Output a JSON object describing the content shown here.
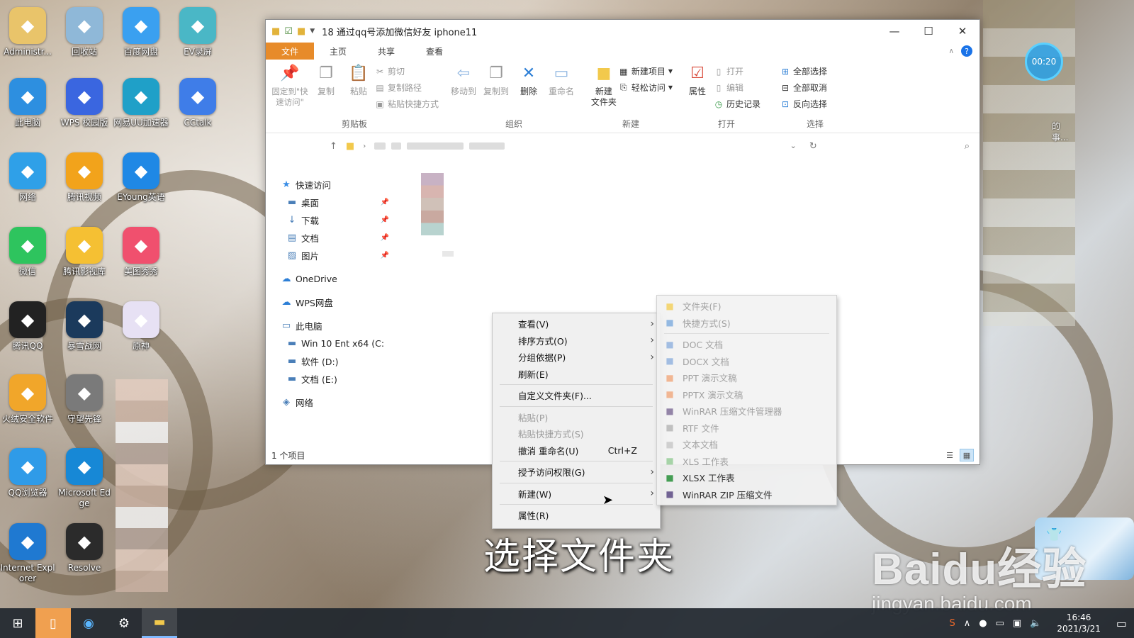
{
  "desktop": {
    "icons": [
      {
        "label": "Administr...",
        "icon": "user-icon",
        "color": "#e9c46a"
      },
      {
        "label": "回收站",
        "icon": "recycle-bin-icon",
        "color": "#8fb8d8"
      },
      {
        "label": "百度网盘",
        "icon": "baidu-netdisk-icon",
        "color": "#3aa0f0"
      },
      {
        "label": "EV录屏",
        "icon": "ev-recorder-icon",
        "color": "#4ab7c6"
      },
      {
        "label": "此电脑",
        "icon": "computer-icon",
        "color": "#2d8fe0"
      },
      {
        "label": "WPS 校园版",
        "icon": "wps-icon",
        "color": "#3a66e0"
      },
      {
        "label": "网易UU加速器",
        "icon": "uu-accelerator-icon",
        "color": "#1fa0c8"
      },
      {
        "label": "CCtalk",
        "icon": "cctalk-icon",
        "color": "#3f7de8"
      },
      {
        "label": "网络",
        "icon": "network-icon",
        "color": "#2fa0e8"
      },
      {
        "label": "腾讯视频",
        "icon": "tencent-video-icon",
        "color": "#f2a31b"
      },
      {
        "label": "EYoung英语",
        "icon": "eyoung-icon",
        "color": "#1f88e5"
      },
      {
        "label": "微信",
        "icon": "wechat-icon",
        "color": "#2ec45e"
      },
      {
        "label": "腾讯影视库",
        "icon": "tencent-film-icon",
        "color": "#f5c033"
      },
      {
        "label": "美图秀秀",
        "icon": "meitu-icon",
        "color": "#f0506e"
      },
      {
        "label": "腾讯QQ",
        "icon": "qq-icon",
        "color": "#222222"
      },
      {
        "label": "暴雪战网",
        "icon": "battlenet-icon",
        "color": "#1b3a5c"
      },
      {
        "label": "原神",
        "icon": "genshin-icon",
        "color": "#e7e1f4"
      },
      {
        "label": "火绒安全软件",
        "icon": "huorong-icon",
        "color": "#f1a62a"
      },
      {
        "label": "守望先锋",
        "icon": "overwatch-icon",
        "color": "#7a7a7a"
      },
      {
        "label": "QQ浏览器",
        "icon": "qq-browser-icon",
        "color": "#2f9be8"
      },
      {
        "label": "Microsoft Edge",
        "icon": "edge-icon",
        "color": "#1788d6"
      },
      {
        "label": "Internet Explorer",
        "icon": "ie-icon",
        "color": "#1f79d1"
      },
      {
        "label": "Resolve",
        "icon": "resolve-icon",
        "color": "#2b2b2b"
      }
    ]
  },
  "explorer": {
    "title": "18 通过qq号添加微信好友 iphone11",
    "tabs": [
      "文件",
      "主页",
      "共享",
      "查看"
    ],
    "ribbon": {
      "clipboard": {
        "name": "剪贴板",
        "pin": "固定到\"快速访问\"",
        "copy": "复制",
        "paste": "粘贴",
        "cut": "剪切",
        "copy_path": "复制路径",
        "paste_shortcut": "粘贴快捷方式"
      },
      "organize": {
        "name": "组织",
        "move_to": "移动到",
        "copy_to": "复制到",
        "delete": "删除",
        "rename": "重命名"
      },
      "new": {
        "name": "新建",
        "new_folder": "新建\n文件夹",
        "new_item": "新建项目",
        "easy_access": "轻松访问"
      },
      "open": {
        "name": "打开",
        "properties": "属性",
        "open": "打开",
        "edit": "编辑",
        "history": "历史记录"
      },
      "select": {
        "name": "选择",
        "select_all": "全部选择",
        "select_none": "全部取消",
        "invert": "反向选择"
      }
    },
    "nav": [
      {
        "label": "快速访问",
        "icon": "star-icon",
        "indent": 0,
        "pinned": false
      },
      {
        "label": "桌面",
        "icon": "desktop-folder-icon",
        "indent": 1,
        "pinned": true
      },
      {
        "label": "下载",
        "icon": "download-icon",
        "indent": 1,
        "pinned": true
      },
      {
        "label": "文档",
        "icon": "document-icon",
        "indent": 1,
        "pinned": true
      },
      {
        "label": "图片",
        "icon": "picture-icon",
        "indent": 1,
        "pinned": true
      },
      {
        "label": "OneDrive",
        "icon": "cloud-icon",
        "indent": 0,
        "pinned": false
      },
      {
        "label": "WPS网盘",
        "icon": "cloud-outline-icon",
        "indent": 0,
        "pinned": false
      },
      {
        "label": "此电脑",
        "icon": "computer-icon",
        "indent": 0,
        "pinned": false
      },
      {
        "label": "Win 10 Ent x64 (C:",
        "icon": "drive-icon",
        "indent": 1,
        "pinned": false
      },
      {
        "label": "软件 (D:)",
        "icon": "drive-icon",
        "indent": 1,
        "pinned": false
      },
      {
        "label": "文档 (E:)",
        "icon": "drive-icon",
        "indent": 1,
        "pinned": false
      },
      {
        "label": "网络",
        "icon": "network-icon",
        "indent": 0,
        "pinned": false
      }
    ],
    "status": "1 个项目"
  },
  "context_menu": {
    "items": [
      {
        "label": "查看(V)",
        "submenu": true,
        "disabled": false
      },
      {
        "label": "排序方式(O)",
        "submenu": true,
        "disabled": false
      },
      {
        "label": "分组依据(P)",
        "submenu": true,
        "disabled": false
      },
      {
        "label": "刷新(E)",
        "submenu": false,
        "disabled": false
      },
      {
        "sep": true
      },
      {
        "label": "自定义文件夹(F)...",
        "submenu": false,
        "disabled": false
      },
      {
        "sep": true
      },
      {
        "label": "粘贴(P)",
        "submenu": false,
        "disabled": true
      },
      {
        "label": "粘贴快捷方式(S)",
        "submenu": false,
        "disabled": true
      },
      {
        "label": "撤消 重命名(U)",
        "shortcut": "Ctrl+Z",
        "submenu": false,
        "disabled": false
      },
      {
        "sep": true
      },
      {
        "label": "授予访问权限(G)",
        "submenu": true,
        "disabled": false
      },
      {
        "sep": true
      },
      {
        "label": "新建(W)",
        "submenu": true,
        "disabled": false
      },
      {
        "sep": true
      },
      {
        "label": "属性(R)",
        "submenu": false,
        "disabled": false
      }
    ]
  },
  "new_submenu": {
    "items": [
      {
        "label": "文件夹(F)",
        "icon": "folder-icon",
        "on": false
      },
      {
        "label": "快捷方式(S)",
        "icon": "shortcut-icon",
        "on": false
      },
      {
        "sep": true
      },
      {
        "label": "DOC 文档",
        "icon": "doc-icon",
        "on": false
      },
      {
        "label": "DOCX 文档",
        "icon": "docx-icon",
        "on": false
      },
      {
        "label": "PPT 演示文稿",
        "icon": "ppt-icon",
        "on": false
      },
      {
        "label": "PPTX 演示文稿",
        "icon": "pptx-icon",
        "on": false
      },
      {
        "label": "WinRAR 压缩文件管理器",
        "icon": "winrar-icon",
        "on": false
      },
      {
        "label": "RTF 文件",
        "icon": "rtf-icon",
        "on": false
      },
      {
        "label": "文本文档",
        "icon": "text-icon",
        "on": false
      },
      {
        "label": "XLS 工作表",
        "icon": "xls-icon",
        "on": false
      },
      {
        "label": "XLSX 工作表",
        "icon": "xlsx-icon",
        "on": true
      },
      {
        "label": "WinRAR ZIP 压缩文件",
        "icon": "zip-icon",
        "on": true
      }
    ]
  },
  "overlay": {
    "subtitle": "选择文件夹",
    "watermark": "Baidu经验",
    "watermark_url": "jingyan.baidu.com",
    "timer": "00:20",
    "right_text": "的\n事..."
  },
  "taskbar": {
    "time": "16:46",
    "date": "2021/3/21"
  }
}
